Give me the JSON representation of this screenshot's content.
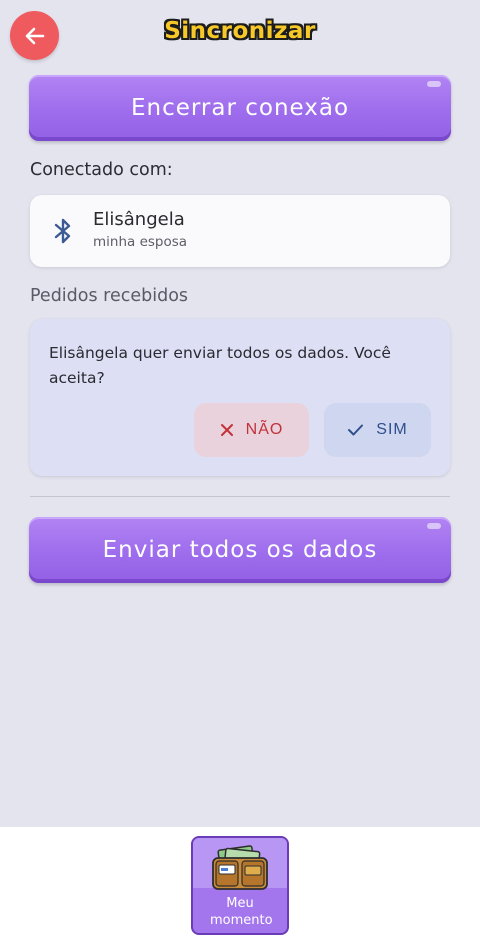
{
  "header": {
    "title": "Sincronizar",
    "back_icon": "arrow-left-icon"
  },
  "actions": {
    "disconnect_label": "Encerrar conexão",
    "send_all_label": "Enviar todos os dados"
  },
  "connected": {
    "label": "Conectado com:",
    "device_name": "Elisângela",
    "device_subtitle": "minha esposa",
    "icon": "bluetooth-icon"
  },
  "requests": {
    "label": "Pedidos recebidos",
    "message": "Elisângela quer enviar todos os dados. Você aceita?",
    "no_label": "NÃO",
    "yes_label": "SIM"
  },
  "bottom_nav": {
    "moment_label": "Meu momento",
    "moment_icon": "wallet-icon"
  },
  "colors": {
    "background": "#e4e4ef",
    "accent_purple": "#9e6ded",
    "back_button": "#ef5a5e",
    "title_yellow": "#f6c928",
    "no_red": "#c2323a",
    "yes_blue": "#2f4f8c"
  }
}
